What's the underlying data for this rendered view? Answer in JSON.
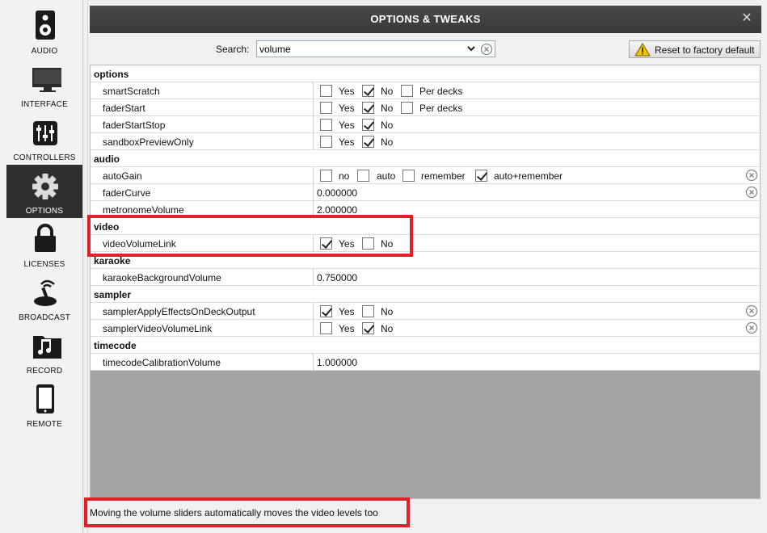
{
  "sidebar": {
    "items": [
      {
        "id": "audio",
        "label": "AUDIO",
        "icon": "speaker-icon"
      },
      {
        "id": "interface",
        "label": "INTERFACE",
        "icon": "monitor-icon"
      },
      {
        "id": "controllers",
        "label": "CONTROLLERS",
        "icon": "mixer-sliders-icon"
      },
      {
        "id": "options",
        "label": "OPTIONS",
        "icon": "gear-icon",
        "active": true
      },
      {
        "id": "licenses",
        "label": "LICENSES",
        "icon": "lock-icon"
      },
      {
        "id": "broadcast",
        "label": "BROADCAST",
        "icon": "broadcast-icon"
      },
      {
        "id": "record",
        "label": "RECORD",
        "icon": "music-folder-icon"
      },
      {
        "id": "remote",
        "label": "REMOTE",
        "icon": "phone-icon"
      }
    ]
  },
  "window": {
    "title": "OPTIONS & TWEAKS",
    "close_glyph": "✕"
  },
  "search": {
    "label": "Search:",
    "value": "volume"
  },
  "reset": {
    "label": "Reset to factory default"
  },
  "groups": {
    "options": {
      "name": "options",
      "rows": {
        "smartScratch": {
          "key": "smartScratch",
          "o1": "Yes",
          "o2": "No",
          "o3": "Per decks"
        },
        "faderStart": {
          "key": "faderStart",
          "o1": "Yes",
          "o2": "No",
          "o3": "Per decks"
        },
        "faderStartStop": {
          "key": "faderStartStop",
          "o1": "Yes",
          "o2": "No"
        },
        "sandboxPreviewOnly": {
          "key": "sandboxPreviewOnly",
          "o1": "Yes",
          "o2": "No"
        }
      }
    },
    "audio": {
      "name": "audio",
      "rows": {
        "autoGain": {
          "key": "autoGain",
          "o1": "no",
          "o2": "auto",
          "o3": "remember",
          "o4": "auto+remember"
        },
        "faderCurve": {
          "key": "faderCurve",
          "value": "0.000000"
        },
        "metronomeVolume": {
          "key": "metronomeVolume",
          "value": "2.000000"
        }
      }
    },
    "video": {
      "name": "video",
      "rows": {
        "videoVolumeLink": {
          "key": "videoVolumeLink",
          "o1": "Yes",
          "o2": "No"
        }
      }
    },
    "karaoke": {
      "name": "karaoke",
      "rows": {
        "karaokeBackgroundVolume": {
          "key": "karaokeBackgroundVolume",
          "value": "0.750000"
        }
      }
    },
    "sampler": {
      "name": "sampler",
      "rows": {
        "samplerApplyEffectsOnDeckOutput": {
          "key": "samplerApplyEffectsOnDeckOutput",
          "o1": "Yes",
          "o2": "No"
        },
        "samplerVideoVolumeLink": {
          "key": "samplerVideoVolumeLink",
          "o1": "Yes",
          "o2": "No"
        }
      }
    },
    "timecode": {
      "name": "timecode",
      "rows": {
        "timecodeCalibrationVolume": {
          "key": "timecodeCalibrationVolume",
          "value": "1.000000"
        }
      }
    }
  },
  "status": {
    "description": "Moving the volume sliders automatically moves the video levels too"
  },
  "colors": {
    "highlight": "#e0202a",
    "titlebar": "#3f3f3f",
    "active_nav": "#2f2f2f",
    "empty_area": "#a4a4a4"
  }
}
